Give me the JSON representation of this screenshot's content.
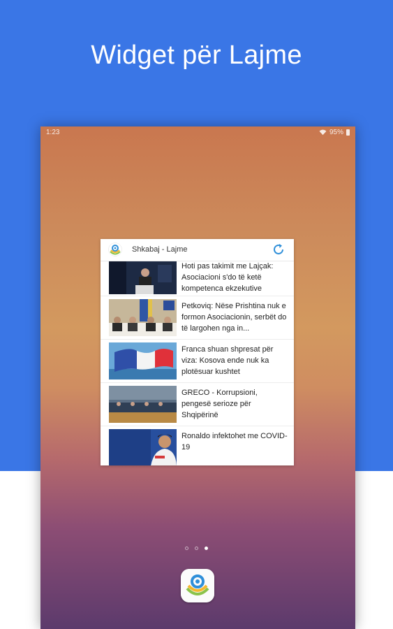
{
  "headline": "Widget për Lajme",
  "status": {
    "time": "1:23",
    "battery": "95%"
  },
  "widget": {
    "title": "Shkabaj - Lajme",
    "articles": [
      {
        "text": "Hoti pas takimit me Lajçak: Asociacioni s'do të ketë kompetenca ekzekutive",
        "thumb": "press-conference-icon"
      },
      {
        "text": "Petkoviq: Nëse Prishtina nuk e formon Asociacionin, serbët do të largohen nga in...",
        "thumb": "meeting-icon"
      },
      {
        "text": "Franca shuan shpresat për viza: Kosova ende nuk ka plotësuar kushtet",
        "thumb": "flag-icon"
      },
      {
        "text": "GRECO - Korrupsioni, pengesë serioze për Shqipërinë",
        "thumb": "assembly-icon"
      },
      {
        "text": "Ronaldo infektohet me COVID-19",
        "thumb": "football-player-icon"
      }
    ]
  },
  "colors": {
    "background": "#3a76e6",
    "accent": "#2f8fd9"
  }
}
